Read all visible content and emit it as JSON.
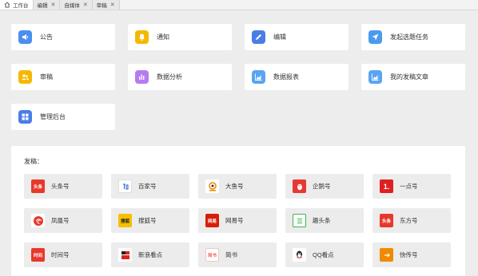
{
  "tabs": [
    {
      "label": "工作台",
      "closable": false,
      "active": true
    },
    {
      "label": "编辑",
      "closable": true,
      "active": false
    },
    {
      "label": "自媒体",
      "closable": true,
      "active": false
    },
    {
      "label": "审稿",
      "closable": true,
      "active": false
    }
  ],
  "cards": [
    {
      "label": "公告",
      "icon": "speaker-icon",
      "color": "#4a8ff0"
    },
    {
      "label": "通知",
      "icon": "bell-icon",
      "color": "#f5b800"
    },
    {
      "label": "编辑",
      "icon": "pencil-icon",
      "color": "#4a7de8"
    },
    {
      "label": "发起选题任务",
      "icon": "send-icon",
      "color": "#4a9af0"
    },
    {
      "label": "审稿",
      "icon": "user-group-icon",
      "color": "#f5b800"
    },
    {
      "label": "数据分析",
      "icon": "bar-chart-icon",
      "color": "#b57cf2"
    },
    {
      "label": "数据报表",
      "icon": "area-chart-icon",
      "color": "#5aa4f2"
    },
    {
      "label": "我的发稿文章",
      "icon": "area-chart-icon",
      "color": "#5aa4f2"
    },
    {
      "label": "管理后台",
      "icon": "grid-icon",
      "color": "#4a7de8"
    }
  ],
  "panel": {
    "title": "发稿：",
    "platforms": [
      {
        "label": "头条号",
        "logo_text": "头条",
        "color": "#e8382c"
      },
      {
        "label": "百家号",
        "logo_text": "",
        "color": "#2a5bd8"
      },
      {
        "label": "大鱼号",
        "logo_text": "",
        "color": "#f08a00"
      },
      {
        "label": "企鹅号",
        "logo_text": "",
        "color": "#e53935"
      },
      {
        "label": "一点号",
        "logo_text": "1.",
        "color": "#e02020"
      },
      {
        "label": "凤凰号",
        "logo_text": "",
        "color": "#e8382c"
      },
      {
        "label": "搜狐号",
        "logo_text": "搜狐",
        "color": "#f5c000"
      },
      {
        "label": "网易号",
        "logo_text": "网易",
        "color": "#d81e06"
      },
      {
        "label": "趣头条",
        "logo_text": "",
        "color": "#3bb54a"
      },
      {
        "label": "东方号",
        "logo_text": "头条",
        "color": "#e8382c"
      },
      {
        "label": "时间号",
        "logo_text": "时间",
        "color": "#e8382c"
      },
      {
        "label": "新浪看点",
        "logo_text": "",
        "color": "#e02020"
      },
      {
        "label": "简书",
        "logo_text": "简书",
        "color": "#ea6f5a"
      },
      {
        "label": "QQ看点",
        "logo_text": "",
        "color": "#222222"
      },
      {
        "label": "快传号",
        "logo_text": "",
        "color": "#f08a00"
      }
    ]
  }
}
